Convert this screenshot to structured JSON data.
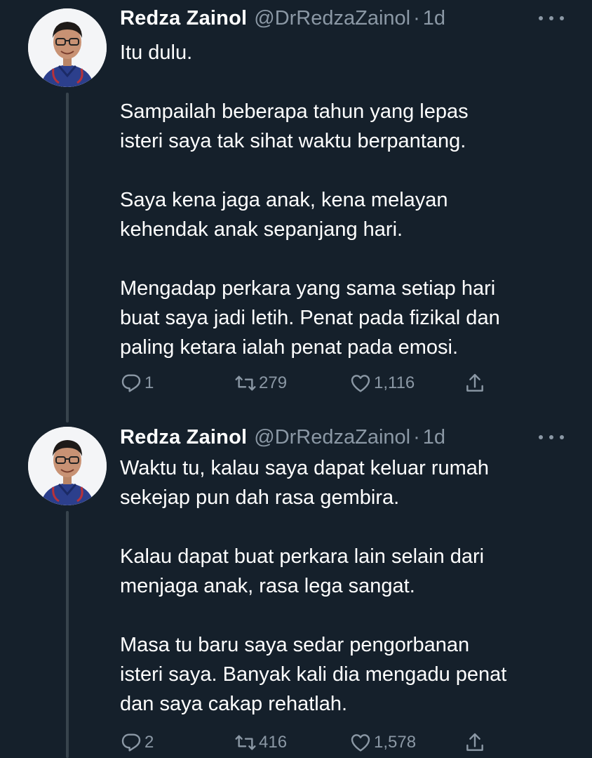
{
  "tweets": [
    {
      "author_name": "Redza Zainol",
      "handle": "@DrRedzaZainol",
      "separator": "·",
      "time": "1d",
      "paragraphs": [
        "Itu dulu.",
        "Sampailah beberapa tahun yang lepas\nisteri saya tak sihat waktu berpantang.",
        "Saya kena jaga anak, kena melayan\nkehendak anak sepanjang hari.",
        "Mengadap perkara yang sama setiap hari\nbuat saya jadi letih. Penat pada fizikal dan\npaling ketara ialah penat pada emosi."
      ],
      "replies": "1",
      "retweets": "279",
      "likes": "1,116"
    },
    {
      "author_name": "Redza Zainol",
      "handle": "@DrRedzaZainol",
      "separator": "·",
      "time": "1d",
      "paragraphs": [
        "Waktu tu, kalau saya dapat keluar rumah\nsekejap pun dah rasa gembira.",
        "Kalau dapat buat perkara lain selain dari\nmenjaga anak, rasa lega sangat.",
        "Masa tu baru saya sedar pengorbanan\nisteri saya. Banyak kali dia mengadu penat\ndan saya cakap rehatlah."
      ],
      "replies": "2",
      "retweets": "416",
      "likes": "1,578"
    }
  ],
  "icons": {
    "reply": "reply-icon",
    "retweet": "retweet-icon",
    "like": "heart-icon",
    "share": "share-icon",
    "more": "more-icon"
  },
  "colors": {
    "background": "#15202b",
    "text": "#ffffff",
    "secondary": "#8b98a5",
    "thread_line": "#38444d"
  }
}
